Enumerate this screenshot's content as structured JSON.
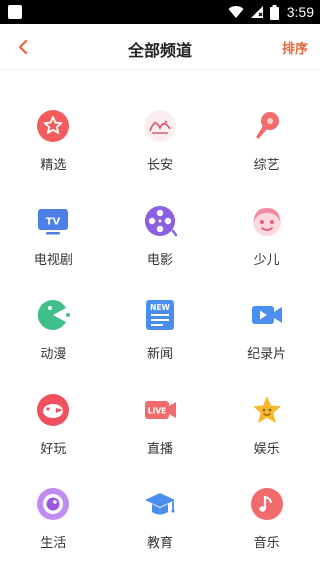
{
  "status_bar": {
    "time": "3:59"
  },
  "header": {
    "title": "全部频道",
    "sort_label": "排序"
  },
  "channels": [
    {
      "label": "精选",
      "icon": "star-badge-icon"
    },
    {
      "label": "长安",
      "icon": "changan-logo-icon"
    },
    {
      "label": "综艺",
      "icon": "microphone-icon"
    },
    {
      "label": "电视剧",
      "icon": "tv-icon"
    },
    {
      "label": "电影",
      "icon": "film-reel-icon"
    },
    {
      "label": "少儿",
      "icon": "kid-face-icon"
    },
    {
      "label": "动漫",
      "icon": "pacman-icon"
    },
    {
      "label": "新闻",
      "icon": "newspaper-icon"
    },
    {
      "label": "纪录片",
      "icon": "video-camera-icon"
    },
    {
      "label": "好玩",
      "icon": "bird-icon"
    },
    {
      "label": "直播",
      "icon": "live-camera-icon"
    },
    {
      "label": "娱乐",
      "icon": "smiling-star-icon"
    },
    {
      "label": "生活",
      "icon": "eye-icon"
    },
    {
      "label": "教育",
      "icon": "graduation-cap-icon"
    },
    {
      "label": "音乐",
      "icon": "music-note-icon"
    }
  ],
  "colors": {
    "accent": "#e8673a"
  }
}
